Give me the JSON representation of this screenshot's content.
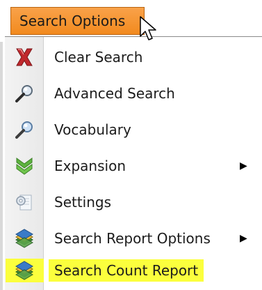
{
  "trigger": {
    "label": "Search Options"
  },
  "menu": {
    "items": [
      {
        "label": "Clear Search",
        "icon": "clear-x-icon",
        "submenu": false
      },
      {
        "label": "Advanced Search",
        "icon": "magnifier-icon",
        "submenu": false
      },
      {
        "label": "Vocabulary",
        "icon": "magnifier-icon",
        "submenu": false
      },
      {
        "label": "Expansion",
        "icon": "double-chevron-down-icon",
        "submenu": true
      },
      {
        "label": "Settings",
        "icon": "settings-icon",
        "submenu": false
      },
      {
        "label": "Search Report Options",
        "icon": "books-icon",
        "submenu": true
      },
      {
        "label": "Search Count Report",
        "icon": "books-icon",
        "submenu": false,
        "highlighted": true
      }
    ],
    "submenu_arrow": "▶"
  },
  "colors": {
    "trigger_bg": "#f28a1e",
    "highlight": "#fbff3d",
    "clear_icon": "#c0282d",
    "expansion_icon": "#5db33f"
  }
}
